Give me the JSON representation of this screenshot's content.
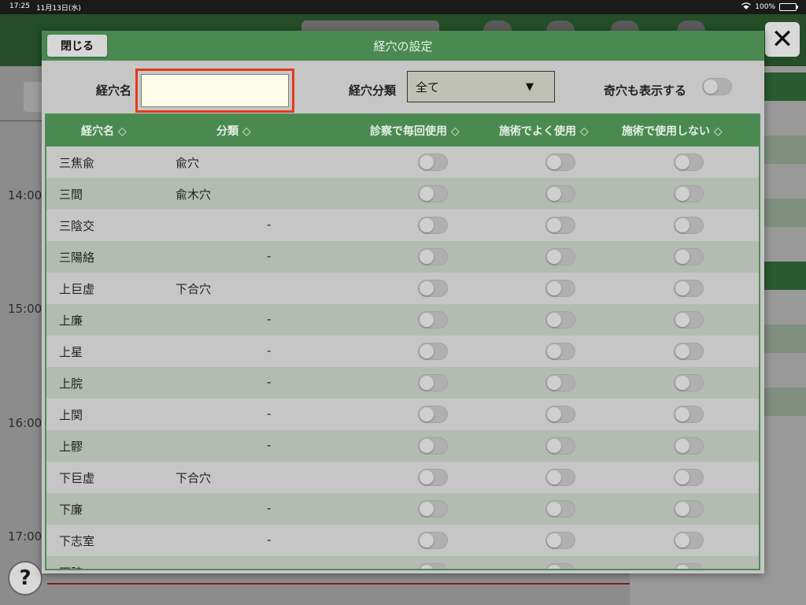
{
  "status_bar": {
    "time": "17:25",
    "date": "11月13日(水)",
    "battery": "100%"
  },
  "background": {
    "times": [
      "14:00",
      "15:00",
      "16:00",
      "17:00"
    ],
    "close_glyph": "✕",
    "help_glyph": "?"
  },
  "modal": {
    "title": "経穴の設定",
    "close_label": "閉じる",
    "filters": {
      "name_label": "経穴名",
      "name_value": "",
      "category_label": "経穴分類",
      "category_value": "全て",
      "category_arrow": "▼",
      "show_odd_label": "奇穴も表示する",
      "show_odd_on": false
    },
    "columns": {
      "name": "経穴名 ◇",
      "category": "分類 ◇",
      "every_exam": "診察で毎回使用 ◇",
      "often_treat": "施術でよく使用 ◇",
      "not_used": "施術で使用しない ◇"
    },
    "rows": [
      {
        "name": "三焦兪",
        "category": "兪穴",
        "dash": ""
      },
      {
        "name": "三間",
        "category": "兪木穴",
        "dash": ""
      },
      {
        "name": "三陰交",
        "category": "",
        "dash": "-"
      },
      {
        "name": "三陽絡",
        "category": "",
        "dash": "-"
      },
      {
        "name": "上巨虚",
        "category": "下合穴",
        "dash": ""
      },
      {
        "name": "上廉",
        "category": "",
        "dash": "-"
      },
      {
        "name": "上星",
        "category": "",
        "dash": "-"
      },
      {
        "name": "上脘",
        "category": "",
        "dash": "-"
      },
      {
        "name": "上関",
        "category": "",
        "dash": "-"
      },
      {
        "name": "上髎",
        "category": "",
        "dash": "-"
      },
      {
        "name": "下巨虚",
        "category": "下合穴",
        "dash": ""
      },
      {
        "name": "下廉",
        "category": "",
        "dash": "-"
      },
      {
        "name": "下志室",
        "category": "",
        "dash": "-"
      },
      {
        "name": "下脘",
        "category": "",
        "dash": "-"
      }
    ]
  },
  "colors": {
    "header_green": "#4a8a51",
    "highlight_red": "#e53a1e",
    "input_bg": "#fdfde9"
  }
}
